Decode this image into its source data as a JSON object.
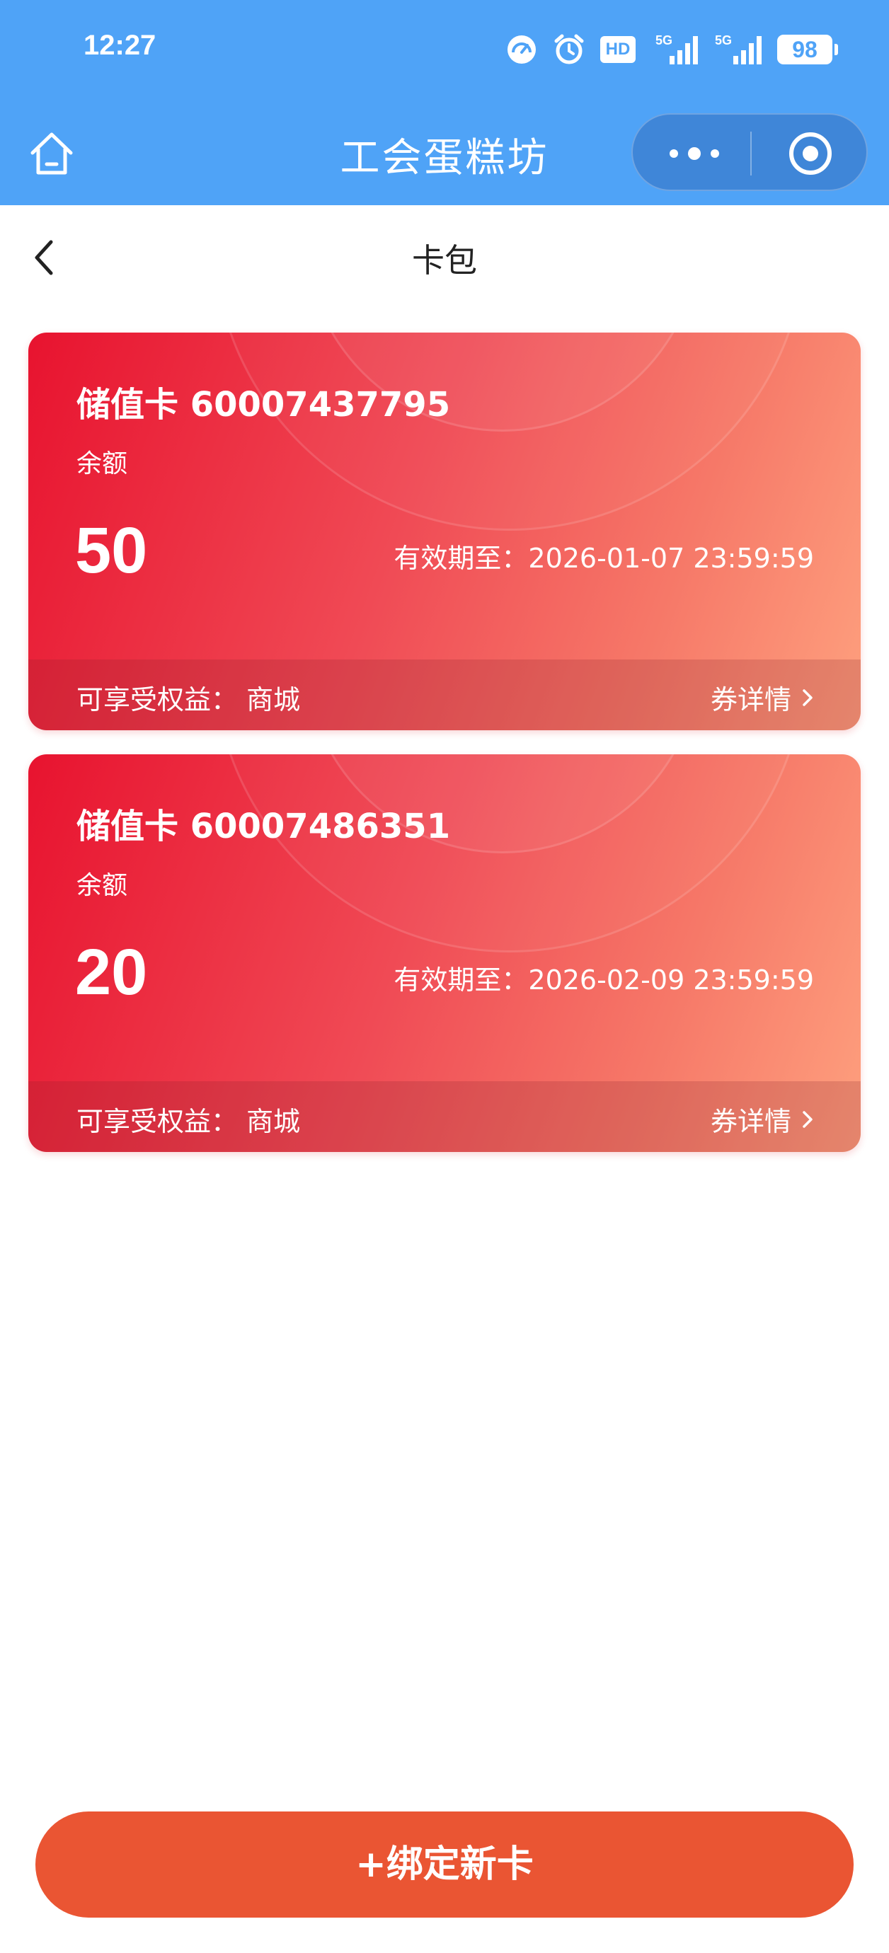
{
  "status_bar": {
    "time": "12:27",
    "hd_label": "HD",
    "signal_label_1": "5G",
    "signal_label_2": "5G",
    "battery": "98"
  },
  "mini_app_bar": {
    "title": "工会蛋糕坊"
  },
  "nav": {
    "title": "卡包"
  },
  "cards": [
    {
      "title": "储值卡 60007437795",
      "balance_label": "余额",
      "balance": "50",
      "expiry": "有效期至：2026-01-07 23:59:59",
      "rights": "可享受权益：  商城",
      "detail_label": "券详情"
    },
    {
      "title": "储值卡 60007486351",
      "balance_label": "余额",
      "balance": "20",
      "expiry": "有效期至：2026-02-09 23:59:59",
      "rights": "可享受权益：  商城",
      "detail_label": "券详情"
    }
  ],
  "bind_button": {
    "label": "+绑定新卡"
  },
  "colors": {
    "topbar": "#4fa3f7",
    "card_start": "#e8132f",
    "card_end": "#fea07e",
    "button": "#ea5533"
  }
}
